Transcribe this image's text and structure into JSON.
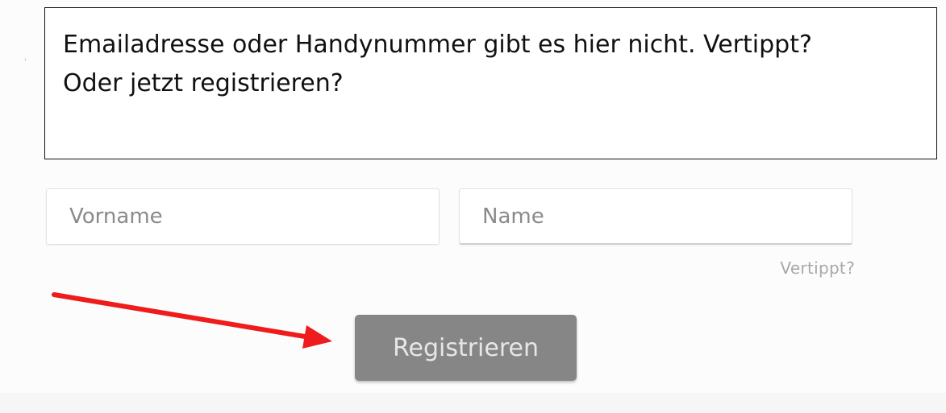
{
  "callout": {
    "line1": "Emailadresse oder Handynummer gibt es hier nicht. Vertippt?",
    "line2": "Oder jetzt registrieren?"
  },
  "form": {
    "firstname_placeholder": "Vorname",
    "lastname_placeholder": "Name",
    "hint_text": "Vertippt?",
    "register_label": "Registrieren"
  },
  "colors": {
    "arrow": "#ee1c1c",
    "button": "#868686"
  }
}
